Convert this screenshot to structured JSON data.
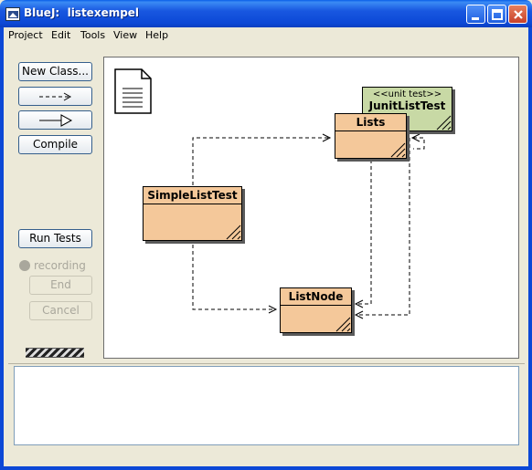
{
  "window": {
    "app_name": "BlueJ:",
    "project_name": "listexempel"
  },
  "menu": {
    "items": [
      "Project",
      "Edit",
      "Tools",
      "View",
      "Help"
    ]
  },
  "toolbar": {
    "new_class_label": "New Class...",
    "uses_arrow_icon": "dashed-arrow-icon",
    "inherits_arrow_icon": "inheritance-arrow-icon",
    "compile_label": "Compile"
  },
  "testing": {
    "run_tests_label": "Run Tests",
    "recording_label": "recording",
    "end_label": "End",
    "cancel_label": "Cancel"
  },
  "diagram": {
    "classes": [
      {
        "name": "Lists",
        "kind": "class"
      },
      {
        "name": "JunitListTest",
        "kind": "unit test",
        "stereotype": "<<unit test>>"
      },
      {
        "name": "SimpleListTest",
        "kind": "class"
      },
      {
        "name": "ListNode",
        "kind": "class"
      }
    ]
  },
  "colors": {
    "class_fill": "#f4c89a",
    "test_fill": "#c8d9a5",
    "titlebar": "#0c48d6"
  }
}
